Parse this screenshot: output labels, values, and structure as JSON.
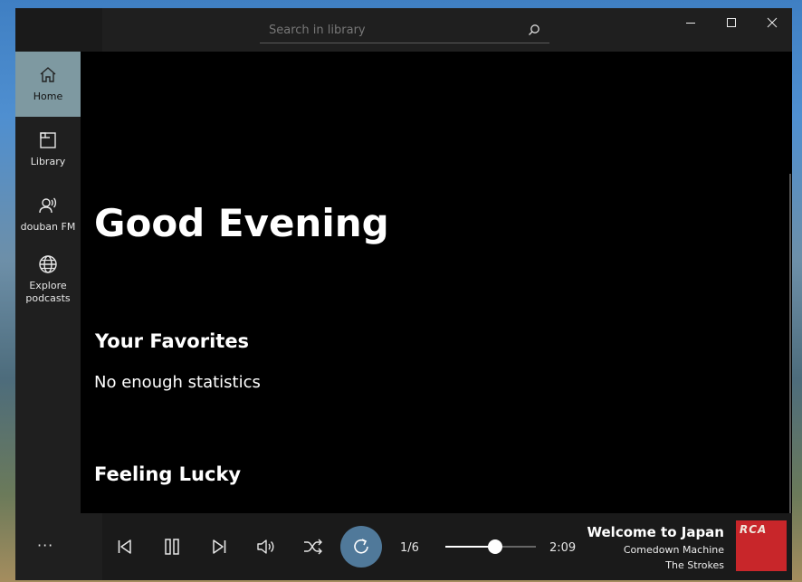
{
  "search": {
    "placeholder": "Search in library"
  },
  "window_controls": {
    "minimize": "minimize",
    "maximize": "maximize",
    "close": "close"
  },
  "sidebar": {
    "items": [
      {
        "label": "Home",
        "icon": "home-icon",
        "active": true
      },
      {
        "label": "Library",
        "icon": "library-icon",
        "active": false
      },
      {
        "label": "douban FM",
        "icon": "radio-person-icon",
        "active": false
      },
      {
        "label": "Explore podcasts",
        "icon": "globe-icon",
        "active": false
      }
    ]
  },
  "main": {
    "greeting": "Good Evening",
    "favorites_title": "Your Favorites",
    "favorites_text": "No enough statistics",
    "lucky_title": "Feeling Lucky"
  },
  "player": {
    "more_label": "···",
    "queue_position": "1/6",
    "time": "2:09",
    "volume_level": 0.55,
    "now_playing": {
      "title": "Welcome to Japan",
      "album": "Comedown Machine",
      "artist": "The Strokes",
      "cover_logo": "RCA"
    }
  },
  "colors": {
    "accent": "#7e99a1",
    "repeat_button": "#50799a",
    "cover": "#c8262a"
  }
}
